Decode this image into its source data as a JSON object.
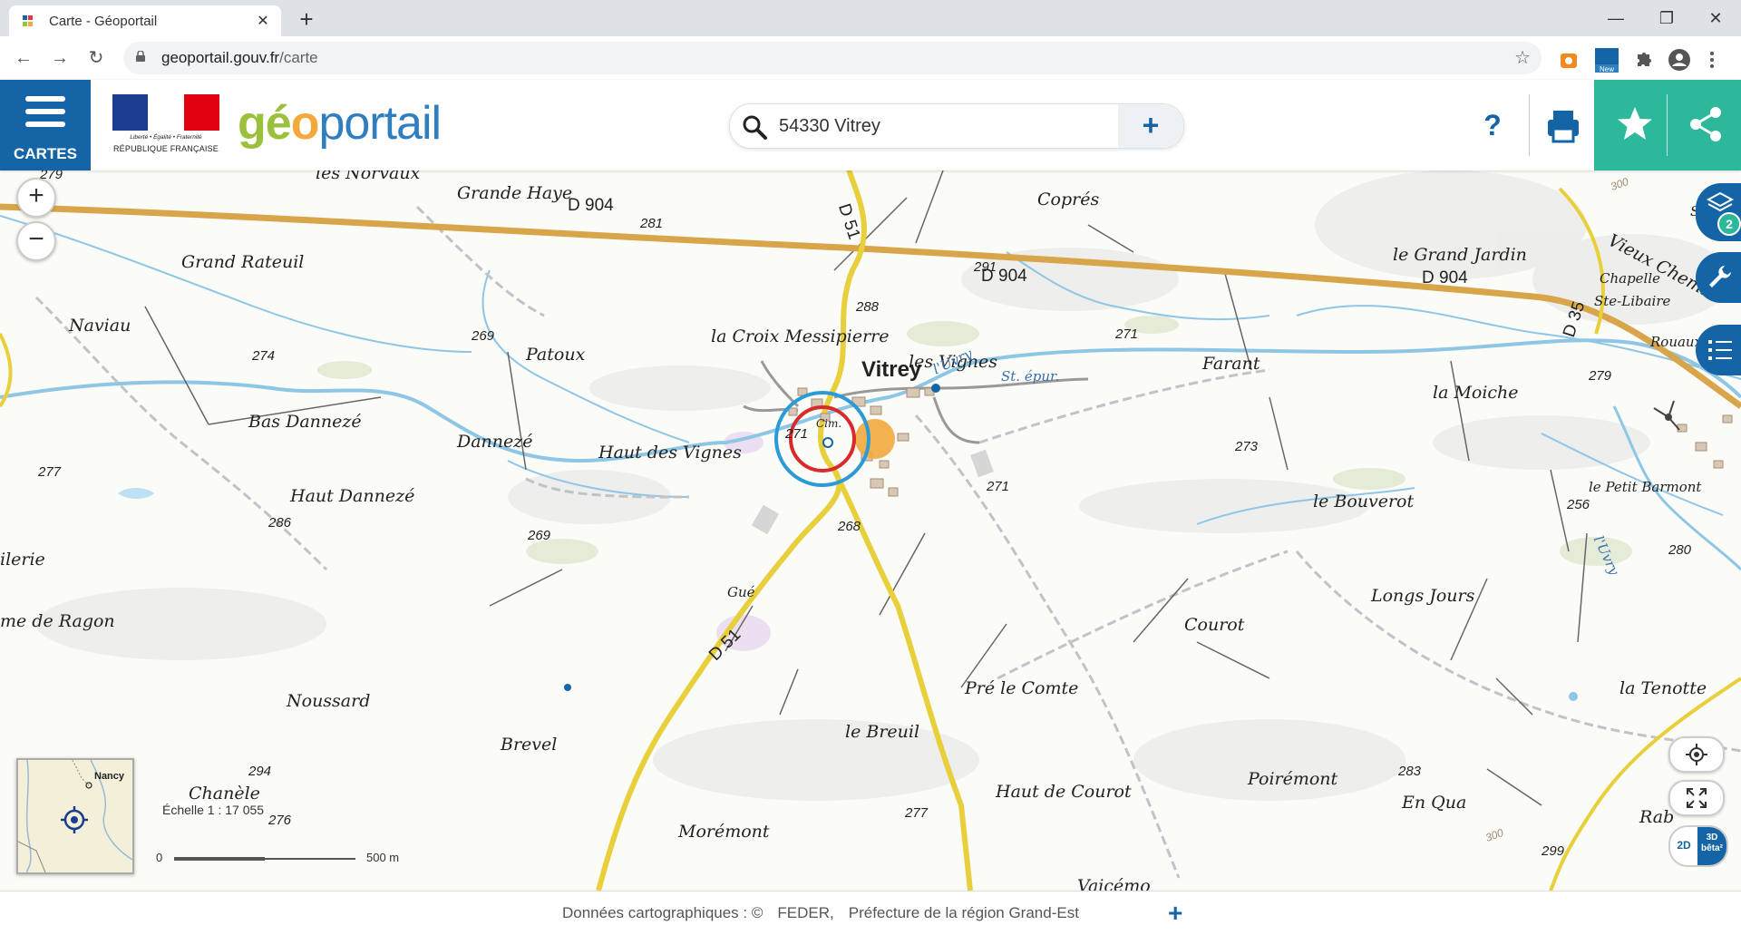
{
  "browser": {
    "tab_title": "Carte - Géoportail",
    "tab_close": "✕",
    "new_tab": "+",
    "url_host": "geoportail.gouv.fr",
    "url_path": "/carte",
    "window": {
      "minimize": "—",
      "maximize": "❐",
      "close": "✕"
    },
    "nav": {
      "back": "←",
      "forward": "→",
      "reload": "↻"
    },
    "star": "☆"
  },
  "header": {
    "cartes_label": "CARTES",
    "republic_motto": "Liberté • Égalité • Fraternité",
    "republic_name": "RÉPUBLIQUE FRANÇAISE",
    "logo_ge": "gé",
    "logo_o": "o",
    "logo_portail": "portail",
    "search_value": "54330 Vitrey",
    "search_add": "+",
    "help": "?"
  },
  "map": {
    "places": [
      {
        "name": "les Norvaux"
      },
      {
        "name": "Grande Haye"
      },
      {
        "name": "Coprés"
      },
      {
        "name": "Grand Rateuil"
      },
      {
        "name": "Naviau"
      },
      {
        "name": "Patoux"
      },
      {
        "name": "la Croix Messipierre"
      },
      {
        "name": "les Vignes"
      },
      {
        "name": "le Grand Jardin"
      },
      {
        "name": "Chapelle"
      },
      {
        "name": "Ste-Libaire"
      },
      {
        "name": "Farant"
      },
      {
        "name": "la Moiche"
      },
      {
        "name": "Bas Dannezé"
      },
      {
        "name": "Dannezé"
      },
      {
        "name": "Haut des Vignes"
      },
      {
        "name": "Haut Dannezé"
      },
      {
        "name": "le Bouverot"
      },
      {
        "name": "le Petit Barmont"
      },
      {
        "name": "ilerie"
      },
      {
        "name": "me de Ragon"
      },
      {
        "name": "Courot"
      },
      {
        "name": "Longs Jours"
      },
      {
        "name": "Pré le Comte"
      },
      {
        "name": "la Tenotte"
      },
      {
        "name": "Noussard"
      },
      {
        "name": "Brevel"
      },
      {
        "name": "le Breuil"
      },
      {
        "name": "Chanèle"
      },
      {
        "name": "Haut de Courot"
      },
      {
        "name": "Poirémont"
      },
      {
        "name": "En Qua"
      },
      {
        "name": "Morémont"
      },
      {
        "name": "Rab"
      },
      {
        "name": "Vaicémo"
      },
      {
        "name": "Sac"
      },
      {
        "name": "Vieux Chemin"
      },
      {
        "name": "Rouaux"
      },
      {
        "name": "Gué"
      },
      {
        "name": "Cim."
      }
    ],
    "town": "Vitrey",
    "water": [
      {
        "name": "l'Uvry"
      },
      {
        "name": "St. épur."
      },
      {
        "name": "l'Uvry"
      }
    ],
    "roads": [
      "D 904",
      "D 904",
      "D 904",
      "D 51",
      "D 51",
      "D 35"
    ],
    "elevations": [
      "279",
      "281",
      "288",
      "291",
      "271",
      "279",
      "274",
      "269",
      "277",
      "286",
      "269",
      "271",
      "268",
      "273",
      "271",
      "256",
      "280",
      "294",
      "276",
      "277",
      "283",
      "299",
      "300",
      "300"
    ],
    "zoom_in": "+",
    "zoom_out": "−",
    "layers_count": "2",
    "overview_label": "Nancy",
    "scale_label": "Échelle 1 : 17 055",
    "scale_start": "0",
    "scale_end": "500 m",
    "mode_2d": "2D",
    "mode_3d": "3D",
    "mode_3d_sub": "bêta²"
  },
  "footer": {
    "attribution_label": "Données cartographiques : ©",
    "attribution_sources": [
      "FEDER,",
      "Préfecture de la région Grand-Est"
    ],
    "more": "+"
  },
  "colors": {
    "brand_blue": "#1565a6",
    "teal": "#2db89b",
    "road_orange": "#d8a54a",
    "road_yellow": "#e8cf3c",
    "water": "#8ec6e6"
  }
}
